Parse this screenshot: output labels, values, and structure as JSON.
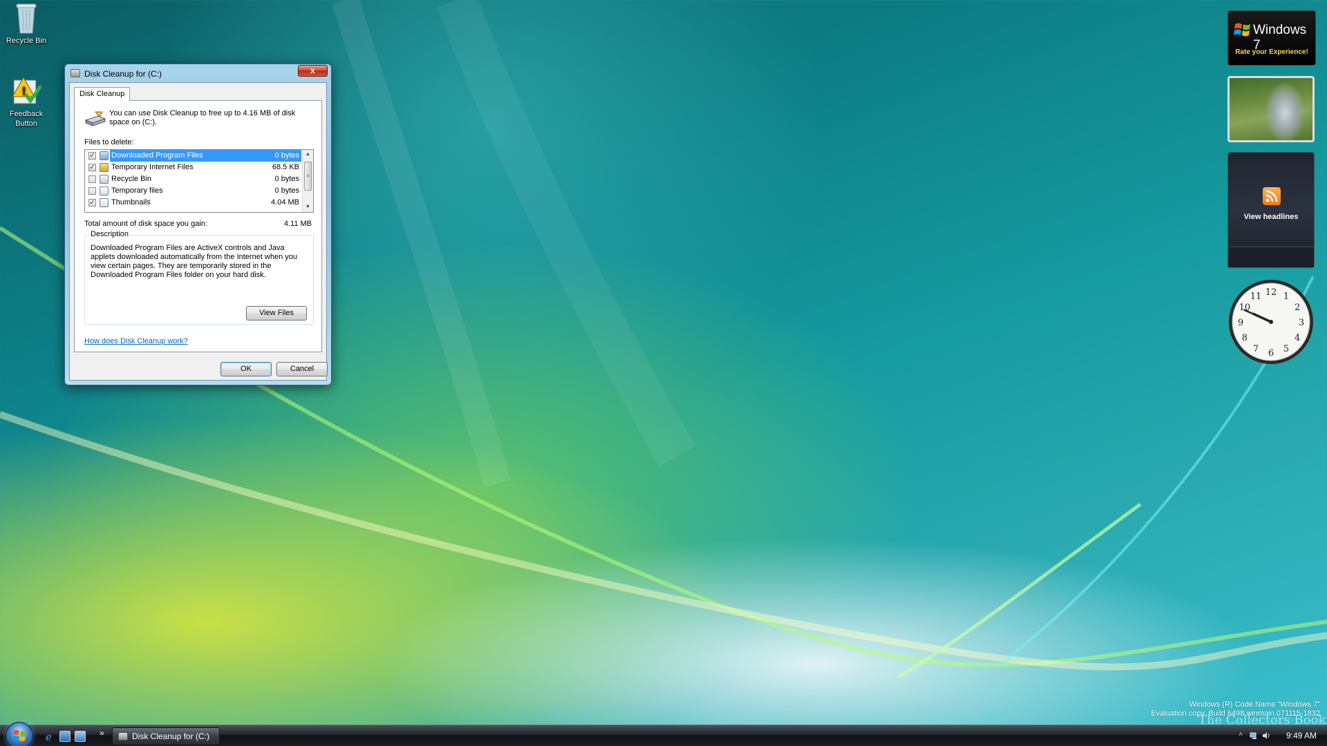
{
  "desktop": {
    "icons": [
      {
        "label": "Recycle Bin",
        "icon": "recycle-bin-icon"
      },
      {
        "label": "Feedback Button",
        "icon": "feedback-icon"
      }
    ]
  },
  "dialog": {
    "title": "Disk Cleanup for  (C:)",
    "close_glyph": "x",
    "tab_label": "Disk Cleanup",
    "intro_text": "You can use Disk Cleanup to free up to 4.16 MB of disk space on  (C:).",
    "files_label": "Files to delete:",
    "files": [
      {
        "name": "Downloaded Program Files",
        "size": "0 bytes",
        "checked": true,
        "selected": true
      },
      {
        "name": "Temporary Internet Files",
        "size": "68.5 KB",
        "checked": true,
        "selected": false
      },
      {
        "name": "Recycle Bin",
        "size": "0 bytes",
        "checked": false,
        "selected": false
      },
      {
        "name": "Temporary files",
        "size": "0 bytes",
        "checked": false,
        "selected": false
      },
      {
        "name": "Thumbnails",
        "size": "4.04 MB",
        "checked": true,
        "selected": false
      }
    ],
    "total_label": "Total amount of disk space you gain:",
    "total_value": "4.11 MB",
    "description_legend": "Description",
    "description_text": "Downloaded Program Files are ActiveX controls and Java applets downloaded automatically from the Internet when you view certain pages. They are temporarily stored in the Downloaded Program Files folder on your hard disk.",
    "view_files_label": "View Files",
    "help_link": "How does Disk Cleanup work?",
    "ok_label": "OK",
    "cancel_label": "Cancel"
  },
  "gadgets": {
    "windows7_title": "Windows 7",
    "windows7_subtitle": "Rate your Experience!",
    "feed_label": "View headlines",
    "clock_time": {
      "hour": 9,
      "minute": 49
    },
    "clock_numbers": [
      "12",
      "1",
      "2",
      "3",
      "4",
      "5",
      "6",
      "7",
      "8",
      "9",
      "10",
      "11"
    ]
  },
  "taskbar": {
    "task_button_label": "Disk Cleanup for  (C:)",
    "clock": "9:49 AM",
    "overflow_glyph": "»"
  },
  "watermark": {
    "line1": "Windows (R) Code Name \"Windows 7\"",
    "line2": "Evaluation copy. Build 6498.winmain.071115-1832",
    "logo_text": "The Collectors Book"
  },
  "colors": {
    "selection": "#3399ff",
    "link": "#0066cc",
    "gadget_accent": "#ffd24a"
  }
}
